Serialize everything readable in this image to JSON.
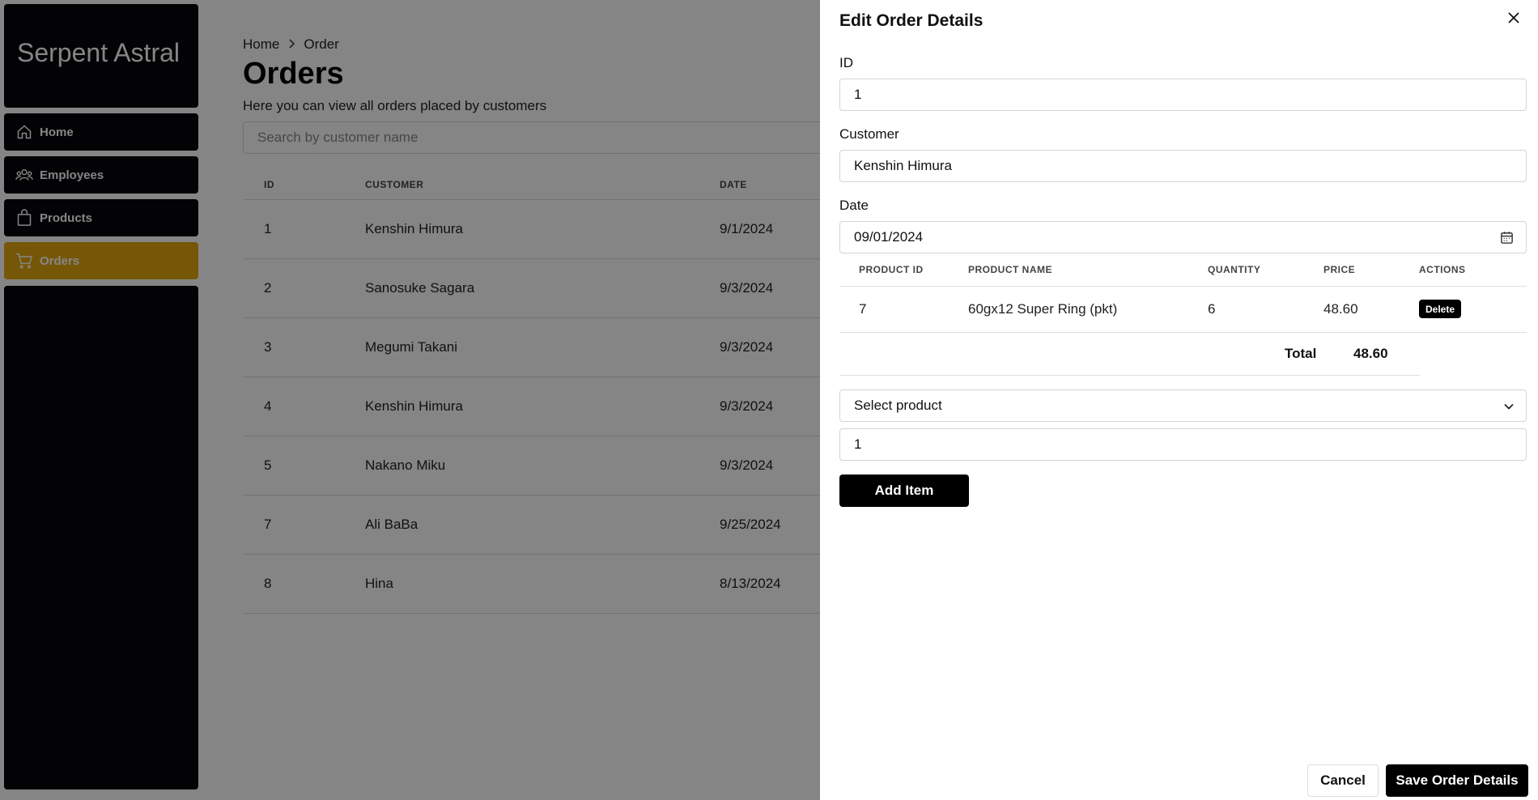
{
  "sidebar": {
    "brand": "Serpent Astral",
    "items": [
      {
        "label": "Home",
        "icon": "home-icon"
      },
      {
        "label": "Employees",
        "icon": "users-icon"
      },
      {
        "label": "Products",
        "icon": "shopping-bag-icon"
      },
      {
        "label": "Orders",
        "icon": "cart-icon",
        "active": true
      }
    ],
    "active_color": "#e0a80e",
    "bg_color": "#06070c"
  },
  "breadcrumb": {
    "items": [
      "Home",
      "Order"
    ]
  },
  "page": {
    "title": "Orders",
    "subtitle": "Here you can view all orders placed by customers"
  },
  "search": {
    "placeholder": "Search by customer name",
    "value": ""
  },
  "orders_table": {
    "headers": [
      "ID",
      "CUSTOMER",
      "DATE"
    ],
    "rows": [
      {
        "id": "1",
        "customer": "Kenshin Himura",
        "date": "9/1/2024"
      },
      {
        "id": "2",
        "customer": "Sanosuke Sagara",
        "date": "9/3/2024"
      },
      {
        "id": "3",
        "customer": "Megumi Takani",
        "date": "9/3/2024"
      },
      {
        "id": "4",
        "customer": "Kenshin Himura",
        "date": "9/3/2024"
      },
      {
        "id": "5",
        "customer": "Nakano Miku",
        "date": "9/3/2024"
      },
      {
        "id": "7",
        "customer": "Ali BaBa",
        "date": "9/25/2024"
      },
      {
        "id": "8",
        "customer": "Hina",
        "date": "8/13/2024"
      }
    ]
  },
  "drawer": {
    "title": "Edit Order Details",
    "fields": {
      "id_label": "ID",
      "id_value": "1",
      "customer_label": "Customer",
      "customer_value": "Kenshin Himura",
      "date_label": "Date",
      "date_value": "09/01/2024"
    },
    "items_table": {
      "headers": [
        "PRODUCT ID",
        "PRODUCT NAME",
        "QUANTITY",
        "PRICE",
        "ACTIONS"
      ],
      "rows": [
        {
          "product_id": "7",
          "product_name": "60gx12 Super Ring (pkt)",
          "quantity": "6",
          "price": "48.60",
          "action": "Delete"
        }
      ]
    },
    "total_label": "Total",
    "total_value": "48.60",
    "select_product": "Select product",
    "quantity_value": "1",
    "add_item": "Add Item",
    "cancel": "Cancel",
    "save": "Save Order Details"
  }
}
